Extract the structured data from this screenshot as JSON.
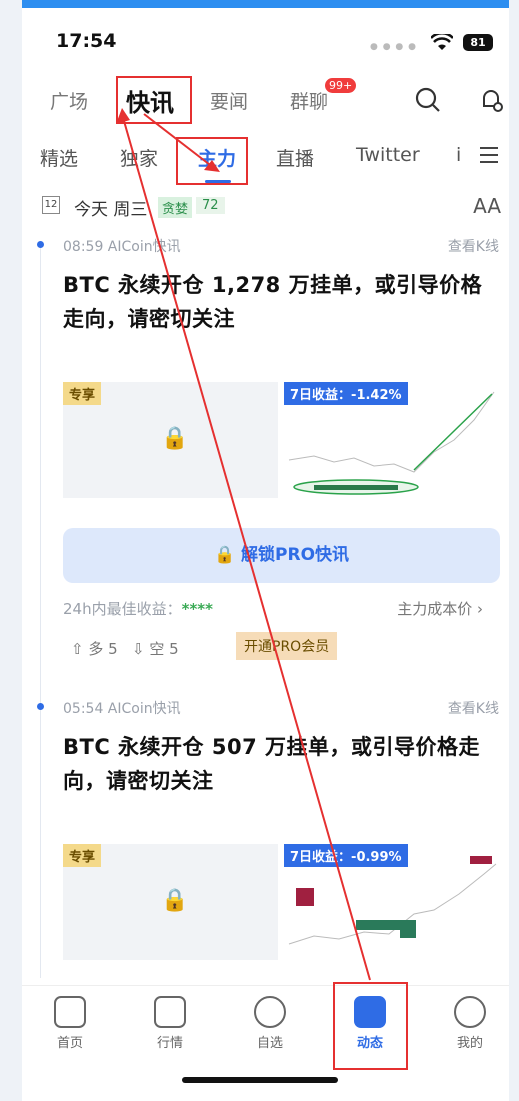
{
  "status_bar": {
    "time": "17:54",
    "battery": "81"
  },
  "top_tabs": [
    {
      "label": "广场"
    },
    {
      "label": "快讯",
      "active": true
    },
    {
      "label": "要闻"
    },
    {
      "label": "群聊",
      "badge": "99+"
    }
  ],
  "sub_tabs": [
    {
      "label": "精选"
    },
    {
      "label": "独家"
    },
    {
      "label": "主力",
      "active": true
    },
    {
      "label": "直播"
    },
    {
      "label": "Twitter"
    },
    {
      "label": "i"
    }
  ],
  "date_bar": {
    "calendar_day": "12",
    "date_text": "今天 周三",
    "greed_label": "贪婪",
    "greed_value": "72",
    "font_size_icon": "AA"
  },
  "news": [
    {
      "time_source": "08:59  AICoin快讯",
      "kline_link": "查看K线",
      "title": "BTC 永续开仓 1,278 万挂单，或引导价格走向，请密切关注",
      "exclusive_tag": "专享",
      "profit_tag": "7日收益：-1.42%"
    },
    {
      "time_source": "05:54  AICoin快讯",
      "kline_link": "查看K线",
      "title": "BTC 永续开仓 507 万挂单，或引导价格走向，请密切关注",
      "exclusive_tag": "专享",
      "profit_tag": "7日收益：-0.99%"
    }
  ],
  "unlock_label": "解锁PRO快讯",
  "best_profit_label": "24h内最佳收益：",
  "best_profit_value": "****",
  "cost_link": "主力成本价 ›",
  "vote_long": "多 5",
  "vote_short": "空 5",
  "open_pro": "开通PRO会员",
  "bottom_nav": [
    {
      "label": "首页",
      "icon": "home-icon"
    },
    {
      "label": "行情",
      "icon": "chart-icon"
    },
    {
      "label": "自选",
      "icon": "plus-circle-icon"
    },
    {
      "label": "动态",
      "icon": "message-icon",
      "active": true
    },
    {
      "label": "我的",
      "icon": "profile-icon"
    }
  ],
  "colors": {
    "accent": "#2f6ce5",
    "annotation": "#e53030",
    "greed": "#2b8f4b"
  }
}
